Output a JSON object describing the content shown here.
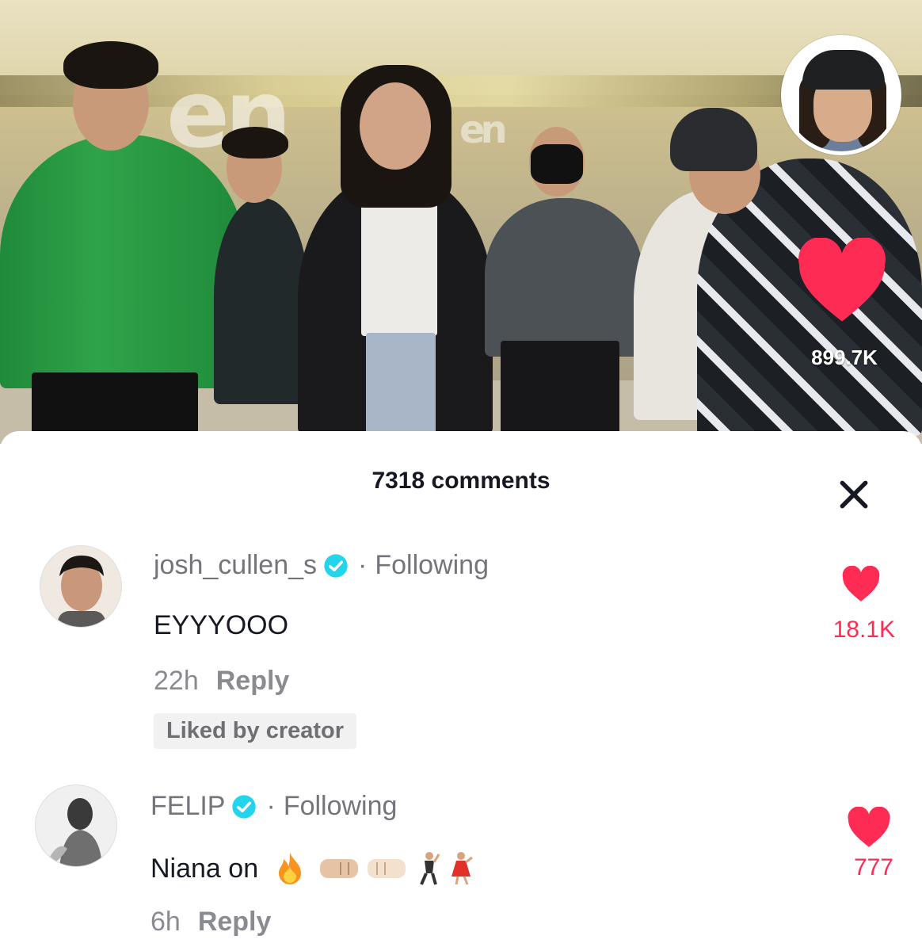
{
  "video": {
    "likes": "899.7K",
    "like_color": "#fe2c55"
  },
  "comments_panel": {
    "title": "7318 comments",
    "close_icon": "close-icon"
  },
  "comments": [
    {
      "username": "josh_cullen_s",
      "verified": true,
      "relation": "Following",
      "text": "EYYYOOO",
      "time": "22h",
      "reply_label": "Reply",
      "badge": "Liked by creator",
      "likes": "18.1K"
    },
    {
      "username": "FELIP",
      "verified": true,
      "relation": "Following",
      "text": "Niana on",
      "emojis": [
        "fire-emoji",
        "fist-bump-emoji",
        "fist-bump-emoji",
        "man-dancing-emoji",
        "woman-dancing-emoji"
      ],
      "time": "6h",
      "reply_label": "Reply",
      "likes": "777"
    }
  ],
  "separator_dot": "·",
  "colors": {
    "accent": "#fe2c55",
    "verified": "#20d5ec",
    "text": "#161823",
    "muted": "#8a8b91"
  }
}
